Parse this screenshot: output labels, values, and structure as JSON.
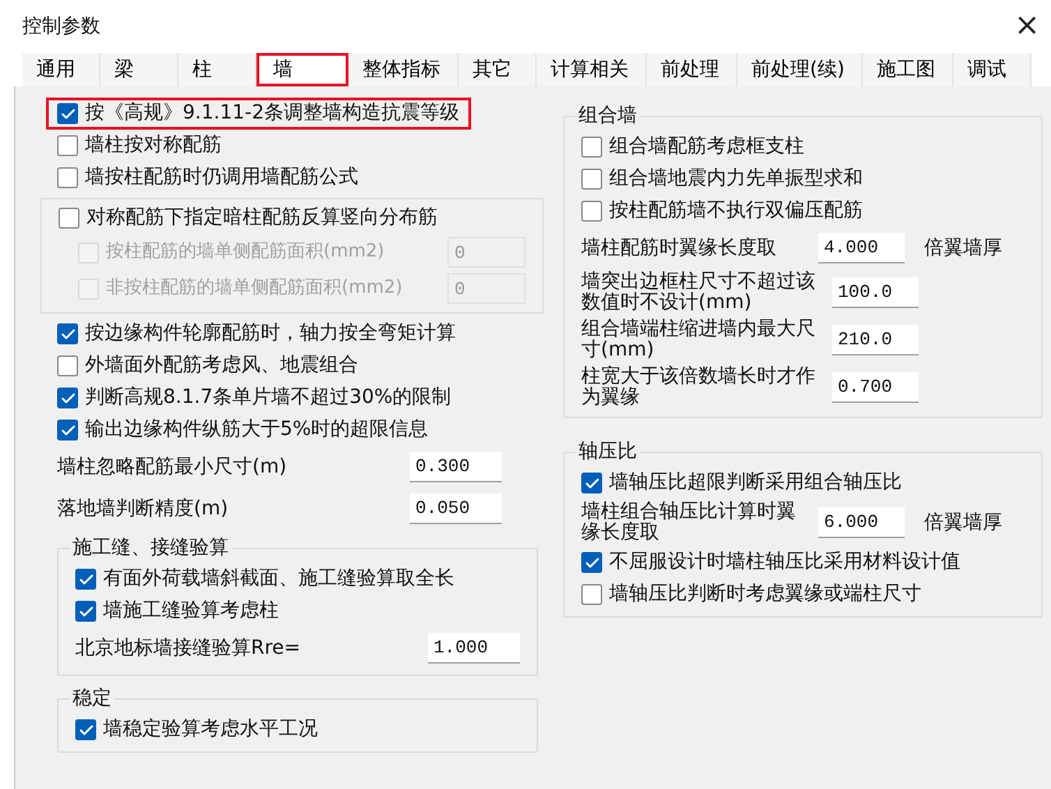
{
  "window": {
    "title": "控制参数",
    "close": "×"
  },
  "tabs": [
    {
      "label": "通用",
      "selected": false,
      "highlighted": false
    },
    {
      "label": "梁",
      "selected": false,
      "highlighted": false
    },
    {
      "label": "柱",
      "selected": false,
      "highlighted": false
    },
    {
      "label": "墙",
      "selected": true,
      "highlighted": true
    },
    {
      "label": "整体指标",
      "selected": false,
      "highlighted": false
    },
    {
      "label": "其它",
      "selected": false,
      "highlighted": false
    },
    {
      "label": "计算相关",
      "selected": false,
      "highlighted": false
    },
    {
      "label": "前处理",
      "selected": false,
      "highlighted": false
    },
    {
      "label": "前处理(续)",
      "selected": false,
      "highlighted": false
    },
    {
      "label": "施工图",
      "selected": false,
      "highlighted": false
    },
    {
      "label": "调试",
      "selected": false,
      "highlighted": false
    }
  ],
  "left": [
    {
      "kind": "checkbox",
      "label": "按《高规》9.1.11-2条调整墙构造抗震等级",
      "checked": true,
      "disabled": false,
      "highlighted": true
    },
    {
      "kind": "checkbox",
      "label": "墙柱按对称配筋",
      "checked": false,
      "disabled": false,
      "highlighted": false
    },
    {
      "kind": "checkbox",
      "label": "墙按柱配筋时仍调用墙配筋公式",
      "checked": false,
      "disabled": false,
      "highlighted": false
    },
    {
      "kind": "group",
      "children": [
        {
          "kind": "checkbox",
          "label": "对称配筋下指定暗柱配筋反算竖向分布筋",
          "checked": false,
          "disabled": false,
          "highlighted": false
        },
        {
          "kind": "checkfield",
          "label": "按柱配筋的墙单侧配筋面积(mm2)",
          "checked": false,
          "disabled": true,
          "value": "0"
        },
        {
          "kind": "checkfield",
          "label": "非按柱配筋的墙单侧配筋面积(mm2)",
          "checked": false,
          "disabled": true,
          "value": "0"
        }
      ]
    },
    {
      "kind": "checkbox",
      "label": "按边缘构件轮廓配筋时，轴力按全弯矩计算",
      "checked": true,
      "disabled": false,
      "highlighted": false
    },
    {
      "kind": "checkbox",
      "label": "外墙面外配筋考虑风、地震组合",
      "checked": false,
      "disabled": false,
      "highlighted": false
    },
    {
      "kind": "checkbox",
      "label": "判断高规8.1.7条单片墙不超过30%的限制",
      "checked": true,
      "disabled": false,
      "highlighted": false
    },
    {
      "kind": "checkbox",
      "label": "输出边缘构件纵筋大于5%时的超限信息",
      "checked": true,
      "disabled": false,
      "highlighted": false
    },
    {
      "kind": "field",
      "label": "墙柱忽略配筋最小尺寸(m)",
      "value": "0.300"
    },
    {
      "kind": "field",
      "label": "落地墙判断精度(m)",
      "value": "0.050"
    },
    {
      "kind": "group",
      "title": "施工缝、接缝验算",
      "children": [
        {
          "kind": "checkbox",
          "label": "有面外荷载墙斜截面、施工缝验算取全长",
          "checked": true,
          "disabled": false,
          "highlighted": false
        },
        {
          "kind": "checkbox",
          "label": "墙施工缝验算考虑柱",
          "checked": true,
          "disabled": false,
          "highlighted": false
        },
        {
          "kind": "field",
          "label": "北京地标墙接缝验算Rre=",
          "value": "1.000"
        }
      ]
    },
    {
      "kind": "group",
      "title": "稳定",
      "children": [
        {
          "kind": "checkbox",
          "label": "墙稳定验算考虑水平工况",
          "checked": true,
          "disabled": false,
          "highlighted": false
        }
      ]
    }
  ],
  "right": [
    {
      "kind": "group",
      "title": "组合墙",
      "children": [
        {
          "kind": "checkbox",
          "label": "组合墙配筋考虑框支柱",
          "checked": false,
          "disabled": false,
          "highlighted": false
        },
        {
          "kind": "checkbox",
          "label": "组合墙地震内力先单振型求和",
          "checked": false,
          "disabled": false,
          "highlighted": false
        },
        {
          "kind": "checkbox",
          "label": "按柱配筋墙不执行双偏压配筋",
          "checked": false,
          "disabled": false,
          "highlighted": false
        },
        {
          "kind": "field",
          "label": "墙柱配筋时翼缘长度取",
          "value": "4.000",
          "suffix": "倍翼墙厚"
        },
        {
          "kind": "field",
          "label": "墙突出边框柱尺寸不超过该数值时不设计(mm)",
          "value": "100.0"
        },
        {
          "kind": "field",
          "label": "组合墙端柱缩进墙内最大尺寸(mm)",
          "value": "210.0"
        },
        {
          "kind": "field",
          "label": "柱宽大于该倍数墙长时才作为翼缘",
          "value": "0.700"
        }
      ]
    },
    {
      "kind": "group",
      "title": "轴压比",
      "children": [
        {
          "kind": "checkbox",
          "label": "墙轴压比超限判断采用组合轴压比",
          "checked": true,
          "disabled": false,
          "highlighted": false
        },
        {
          "kind": "field",
          "label": "墙柱组合轴压比计算时翼缘长度取",
          "value": "6.000",
          "suffix": "倍翼墙厚"
        },
        {
          "kind": "checkbox",
          "label": "不屈服设计时墙柱轴压比采用材料设计值",
          "checked": true,
          "disabled": false,
          "highlighted": false
        },
        {
          "kind": "checkbox",
          "label": "墙轴压比判断时考虑翼缘或端柱尺寸",
          "checked": false,
          "disabled": false,
          "highlighted": false
        }
      ]
    }
  ]
}
